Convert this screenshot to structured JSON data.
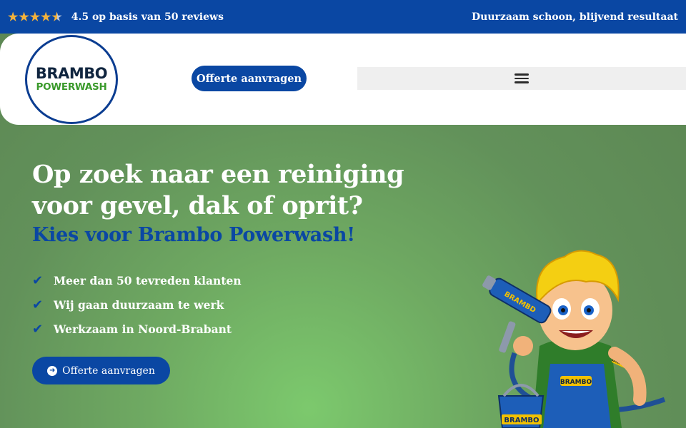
{
  "topbar": {
    "rating_value": 4.5,
    "rating_max": 5,
    "rating_text": "4.5 op basis van 50 reviews",
    "tagline": "Duurzaam schoon, blijvend resultaat"
  },
  "header": {
    "logo": {
      "line1": "BRAMBO",
      "line2": "POWERWASH"
    },
    "cta_label": "Offerte aanvragen",
    "menu_icon": "hamburger-icon"
  },
  "hero": {
    "title": "Op zoek naar een reiniging voor gevel, dak of oprit?",
    "subtitle": "Kies voor Brambo Powerwash!",
    "bullets": [
      "Meer dan 50 tevreden klanten",
      "Wij gaan duurzaam te werk",
      "Werkzaam in Noord-Brabant"
    ],
    "cta_label": "Offerte aanvragen",
    "mascot_text": {
      "gun": "BRAMBD",
      "shirt": "BRAMBO",
      "overalls": "BRAMBO",
      "bucket": "BRAMBO"
    }
  },
  "colors": {
    "brand_blue": "#0a47a3",
    "star": "#f3b23c",
    "hero_green": "#6faa62",
    "logo_green": "#3a9a2b"
  }
}
